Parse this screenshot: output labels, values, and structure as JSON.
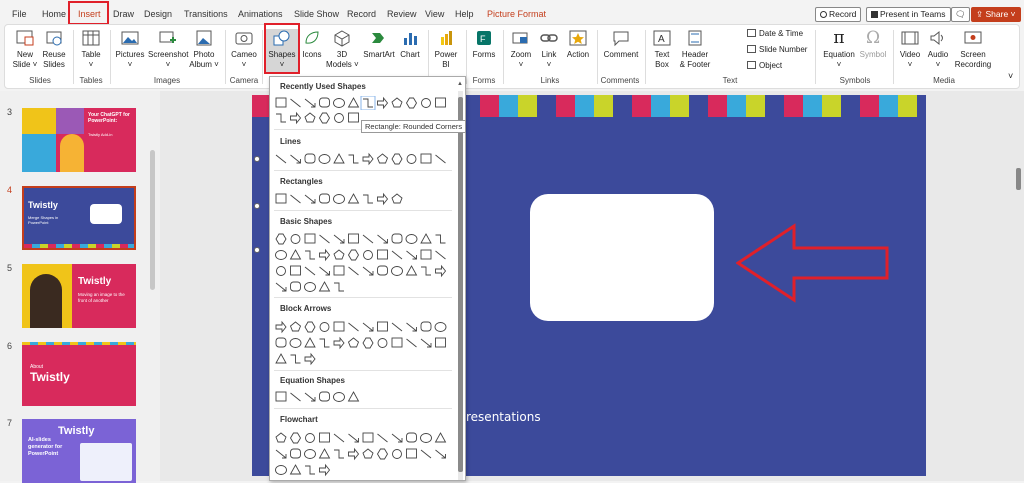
{
  "tabs": {
    "file": "File",
    "home": "Home",
    "insert": "Insert",
    "draw": "Draw",
    "design": "Design",
    "transitions": "Transitions",
    "animations": "Animations",
    "slide_show": "Slide Show",
    "record": "Record",
    "review": "Review",
    "view": "View",
    "help": "Help",
    "picture_format": "Picture Format"
  },
  "toolbar": {
    "record_label": "Record",
    "present_label": "Present in Teams",
    "share_label": "Share"
  },
  "ribbon": {
    "new_slide": [
      "New",
      "Slide ˅"
    ],
    "reuse_slides": [
      "Reuse",
      "Slides"
    ],
    "table": [
      "Table",
      "˅"
    ],
    "pictures": [
      "Pictures",
      "˅"
    ],
    "screenshot": [
      "Screenshot",
      "˅"
    ],
    "photo_album": [
      "Photo",
      "Album ˅"
    ],
    "cameo": [
      "Cameo",
      "˅"
    ],
    "shapes": [
      "Shapes",
      "˅"
    ],
    "icons": [
      "Icons"
    ],
    "models_3d": [
      "3D",
      "Models ˅"
    ],
    "smartart": [
      "SmartArt"
    ],
    "chart": [
      "Chart"
    ],
    "power_bi": [
      "Power",
      "BI"
    ],
    "forms": [
      "Forms"
    ],
    "zoom": [
      "Zoom",
      "˅"
    ],
    "link": [
      "Link",
      "˅"
    ],
    "action": [
      "Action"
    ],
    "comment": [
      "Comment"
    ],
    "text_box": [
      "Text",
      "Box"
    ],
    "header_footer": [
      "Header",
      "& Footer"
    ],
    "date_time": "Date & Time",
    "slide_number": "Slide Number",
    "object": "Object",
    "equation": [
      "Equation",
      "˅"
    ],
    "symbol": [
      "Symbol"
    ],
    "video": [
      "Video",
      "˅"
    ],
    "audio": [
      "Audio",
      "˅"
    ],
    "screen_recording": [
      "Screen",
      "Recording"
    ]
  },
  "groups": {
    "slides": "Slides",
    "tables": "Tables",
    "images": "Images",
    "camera": "Camera",
    "forms": "Forms",
    "links": "Links",
    "comments": "Comments",
    "text": "Text",
    "symbols": "Symbols",
    "media": "Media"
  },
  "slides_panel": {
    "numbers": [
      "3",
      "4",
      "5",
      "6",
      "7"
    ],
    "slide3": {
      "title": "Your ChatGPT for PowerPoint:",
      "subtitle": "Twistly Add-in"
    },
    "slide4": {
      "title": "Twistly",
      "subtitle": "Merge Shapes in PowerPoint"
    },
    "slide5": {
      "title": "Twistly",
      "subtitle": "Moving an image to the front of another"
    },
    "slide6": {
      "small": "About",
      "title": "Twistly"
    },
    "slide7": {
      "title": "Twistly",
      "subtitle": "AI-slides generator for PowerPoint"
    }
  },
  "slide": {
    "partial_text": "resentations"
  },
  "shapes_menu": {
    "recently_used": "Recently Used Shapes",
    "lines": "Lines",
    "rectangles": "Rectangles",
    "basic_shapes": "Basic Shapes",
    "block_arrows": "Block Arrows",
    "equation_shapes": "Equation Shapes",
    "flowchart": "Flowchart",
    "tooltip": "Rectangle: Rounded Corners"
  },
  "colors": {
    "accent": "#c43e1c",
    "highlight": "#e0202a",
    "slide_bg": "#3c4a9b"
  }
}
